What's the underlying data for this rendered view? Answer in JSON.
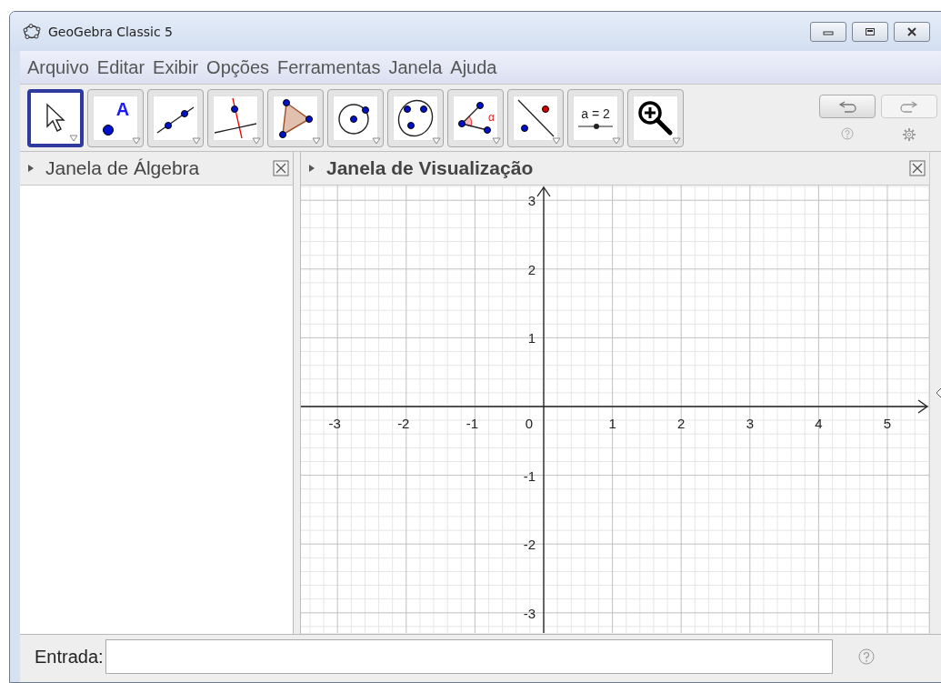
{
  "window": {
    "title": "GeoGebra Classic 5"
  },
  "menu": [
    "Arquivo",
    "Editar",
    "Exibir",
    "Opções",
    "Ferramentas",
    "Janela",
    "Ajuda"
  ],
  "tools": [
    {
      "kind": "move",
      "selected": true
    },
    {
      "kind": "point",
      "label": "A",
      "selected": false
    },
    {
      "kind": "line",
      "selected": false
    },
    {
      "kind": "perpendicular",
      "selected": false
    },
    {
      "kind": "polygon",
      "selected": false
    },
    {
      "kind": "circle",
      "selected": false
    },
    {
      "kind": "conic",
      "selected": false
    },
    {
      "kind": "angle",
      "label": "α",
      "selected": false
    },
    {
      "kind": "reflect",
      "selected": false
    },
    {
      "kind": "slider",
      "label": "a = 2",
      "selected": false
    },
    {
      "kind": "zoom",
      "selected": false
    }
  ],
  "algebra_view": {
    "title": "Janela de Álgebra"
  },
  "graphics_view": {
    "title": "Janela de Visualização",
    "x_labels": [
      "-3",
      "-2",
      "-1",
      "0",
      "1",
      "2",
      "3",
      "4",
      "5"
    ],
    "y_labels": [
      "3",
      "2",
      "1",
      "-1",
      "-2",
      "-3"
    ]
  },
  "input_bar": {
    "label": "Entrada:"
  }
}
